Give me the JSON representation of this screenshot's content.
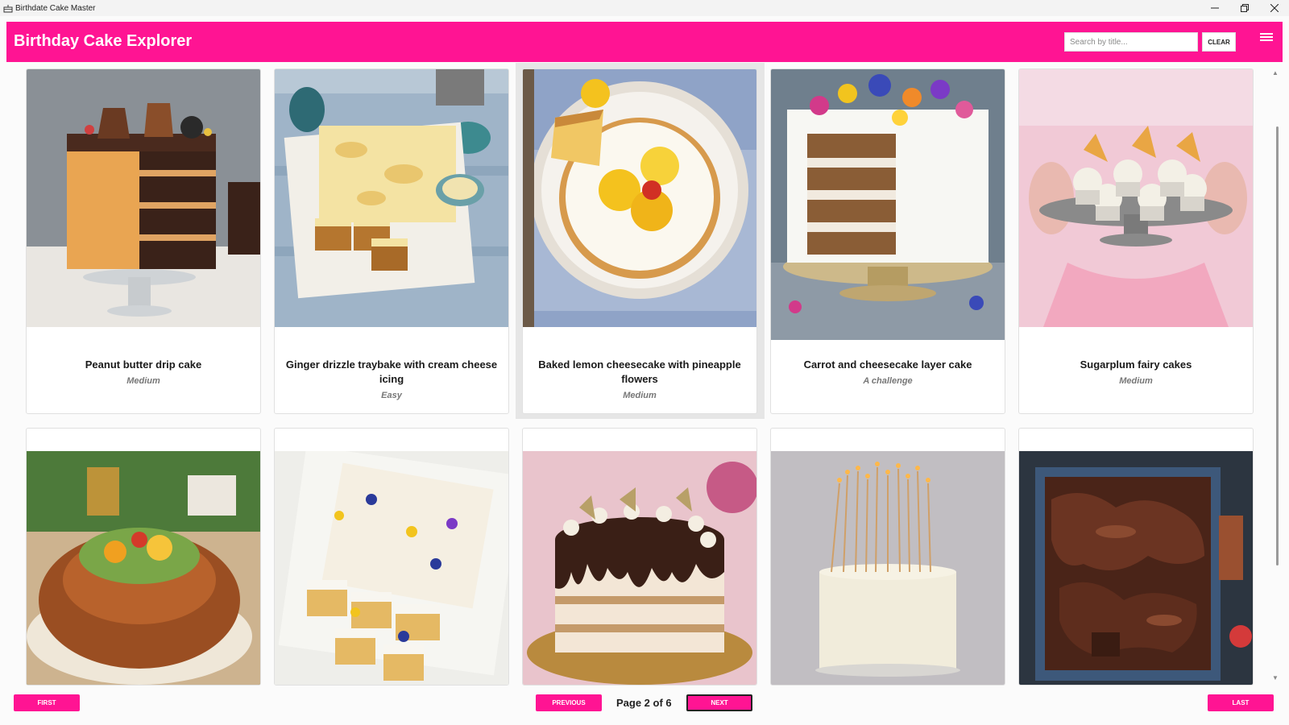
{
  "window": {
    "title": "Birthdate Cake Master",
    "controls": [
      "minimize-icon",
      "restore-icon",
      "close-icon"
    ]
  },
  "header": {
    "title": "Birthday Cake Explorer",
    "search_placeholder": "Search by title...",
    "search_value": "",
    "clear_label": "CLEAR",
    "menu_icon": "hamburger-menu-icon"
  },
  "theme": {
    "accent": "#ff1493"
  },
  "cakes": [
    {
      "title": "Peanut butter drip cake",
      "difficulty": "Medium"
    },
    {
      "title": "Ginger drizzle traybake with cream cheese icing",
      "difficulty": "Easy"
    },
    {
      "title": "Baked lemon cheesecake with pineapple flowers",
      "difficulty": "Medium"
    },
    {
      "title": "Carrot and cheesecake layer cake",
      "difficulty": "A challenge"
    },
    {
      "title": "Sugarplum fairy cakes",
      "difficulty": "Medium"
    }
  ],
  "pagination": {
    "first_label": "FIRST",
    "previous_label": "PREVIOUS",
    "page_text": "Page 2 of 6",
    "next_label": "NEXT",
    "last_label": "LAST"
  }
}
